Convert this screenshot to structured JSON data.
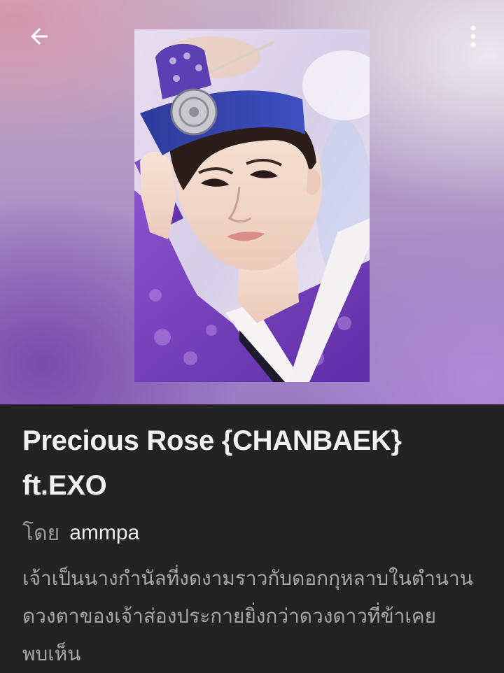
{
  "header": {
    "back_icon": "arrow-left-icon",
    "menu_icon": "more-vertical-icon"
  },
  "story": {
    "title": "Precious Rose {CHANBAEK} ft.EXO",
    "author_prefix": "โดย",
    "author": "ammpa",
    "synopsis": "เจ้าเป็นนางกำนัลที่งดงามราวกับดอกกุหลาบในตำนาน ดวงตาของเจ้าส่องประกายยิ่งกว่าดวงดาวที่ข้าเคยพบเห็น"
  },
  "colors": {
    "info_background": "#232323",
    "title": "#f1f1f1",
    "muted_text": "#a6a6a6"
  }
}
